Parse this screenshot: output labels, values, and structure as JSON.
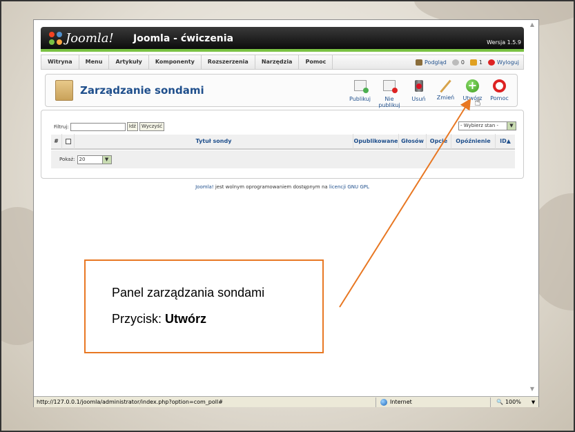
{
  "header": {
    "logo_text": "Joomla!",
    "site_name": "Joomla - ćwiczenia",
    "version": "Wersja 1.5.9"
  },
  "menu": {
    "items": [
      {
        "label": "Witryna"
      },
      {
        "label": "Menu"
      },
      {
        "label": "Artykuły"
      },
      {
        "label": "Komponenty"
      },
      {
        "label": "Rozszerzenia"
      },
      {
        "label": "Narzędzia"
      },
      {
        "label": "Pomoc"
      }
    ],
    "preview_label": "Podgląd",
    "messages_count": "0",
    "users_count": "1",
    "logout_label": "Wyloguj"
  },
  "page": {
    "title": "Zarządzanie sondami"
  },
  "toolbar": {
    "publish": "Publikuj",
    "unpublish": "Nie publikuj",
    "delete": "Usuń",
    "edit": "Zmień",
    "new": "Utwórz",
    "help": "Pomoc"
  },
  "filter": {
    "label": "Filtruj:",
    "value": "",
    "go": "Idź",
    "reset": "Wyczyść",
    "state_select": "- Wybierz stan -"
  },
  "table": {
    "columns": [
      "#",
      "",
      "Tytuł sondy",
      "Opublikowane",
      "Głosów",
      "Opcje",
      "Opóźnienie",
      "ID"
    ],
    "rows": [],
    "limit_label": "Pokaż:",
    "limit_value": "20"
  },
  "credits": {
    "brand": "Joomla!",
    "text_before": " jest wolnym oprogramowaniem dostępnym na ",
    "license": "licencji GNU GPL"
  },
  "statusbar": {
    "url": "http://127.0.0.1/joomla/administrator/index.php?option=com_poll#",
    "zone": "Internet",
    "zoom": "100%"
  },
  "callout": {
    "line1": "Panel zarządzania sondami",
    "line2_prefix": "Przycisk: ",
    "line2_bold": "Utwórz"
  },
  "colors": {
    "accent_green": "#7ac143",
    "link_blue": "#1f4f8c",
    "callout_orange": "#e87722"
  }
}
